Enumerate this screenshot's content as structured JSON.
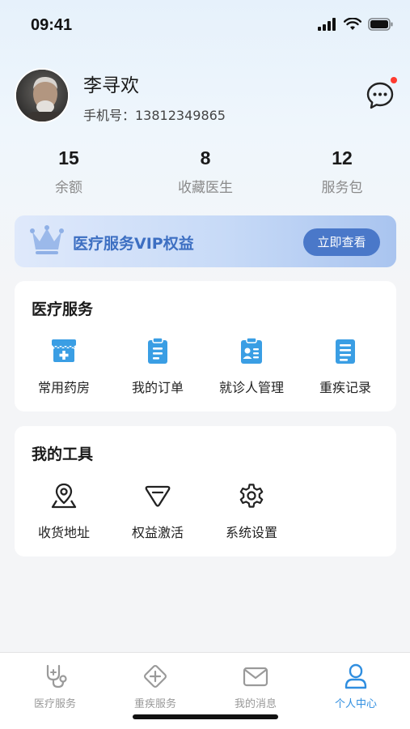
{
  "status_bar": {
    "time": "09:41"
  },
  "profile": {
    "name": "李寻欢",
    "phone": "手机号：13812349865",
    "has_unread": true
  },
  "stats": [
    {
      "value": "15",
      "label": "余额"
    },
    {
      "value": "8",
      "label": "收藏医生"
    },
    {
      "value": "12",
      "label": "服务包"
    }
  ],
  "vip_banner": {
    "title": "医疗服务VIP权益",
    "button": "立即查看"
  },
  "medical_services": {
    "title": "医疗服务",
    "items": [
      {
        "label": "常用药房",
        "icon": "pharmacy-icon"
      },
      {
        "label": "我的订单",
        "icon": "order-clipboard-icon"
      },
      {
        "label": "就诊人管理",
        "icon": "patient-card-icon"
      },
      {
        "label": "重疾记录",
        "icon": "record-list-icon"
      }
    ]
  },
  "my_tools": {
    "title": "我的工具",
    "items": [
      {
        "label": "收货地址",
        "icon": "location-pin-icon"
      },
      {
        "label": "权益激活",
        "icon": "diamond-icon"
      },
      {
        "label": "系统设置",
        "icon": "gear-icon"
      }
    ]
  },
  "tab_bar": {
    "active": "个人中心",
    "tabs": [
      {
        "label": "医疗服务",
        "icon": "stethoscope-icon"
      },
      {
        "label": "重疾服务",
        "icon": "plus-diamond-icon"
      },
      {
        "label": "我的消息",
        "icon": "envelope-icon"
      },
      {
        "label": "个人中心",
        "icon": "person-icon"
      }
    ]
  },
  "colors": {
    "accent": "#2f8ee0",
    "icon_blue": "#3a9ee4",
    "vip_text": "#3d6fc2",
    "vip_button": "#4a78c9",
    "badge_red": "#ff3b30"
  }
}
